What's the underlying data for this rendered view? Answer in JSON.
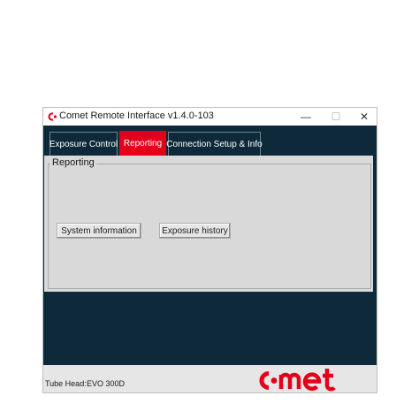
{
  "window": {
    "title": "Comet Remote Interface v1.4.0-103",
    "minimize_glyph": "—",
    "maximize_glyph": "☐",
    "close_glyph": "✕"
  },
  "tabs": [
    {
      "label": "Exposure Control",
      "active": false
    },
    {
      "label": "Reporting",
      "active": true
    },
    {
      "label": "Connection Setup & Info",
      "active": false
    }
  ],
  "reporting": {
    "group_label": "Reporting",
    "system_information_label": "System information",
    "exposure_history_label": "Exposure history"
  },
  "footer": {
    "tube_head_label": "Tube Head:",
    "tube_head_value": "EVO 300D"
  },
  "colors": {
    "brand_red": "#e3001b",
    "dark_navy": "#0e2a3a",
    "panel_gray": "#d9d9d9"
  },
  "icons": {
    "app": "comet-logo-icon",
    "minimize": "minimize-icon",
    "maximize": "maximize-icon",
    "close": "close-icon",
    "logo": "comet-logo"
  }
}
